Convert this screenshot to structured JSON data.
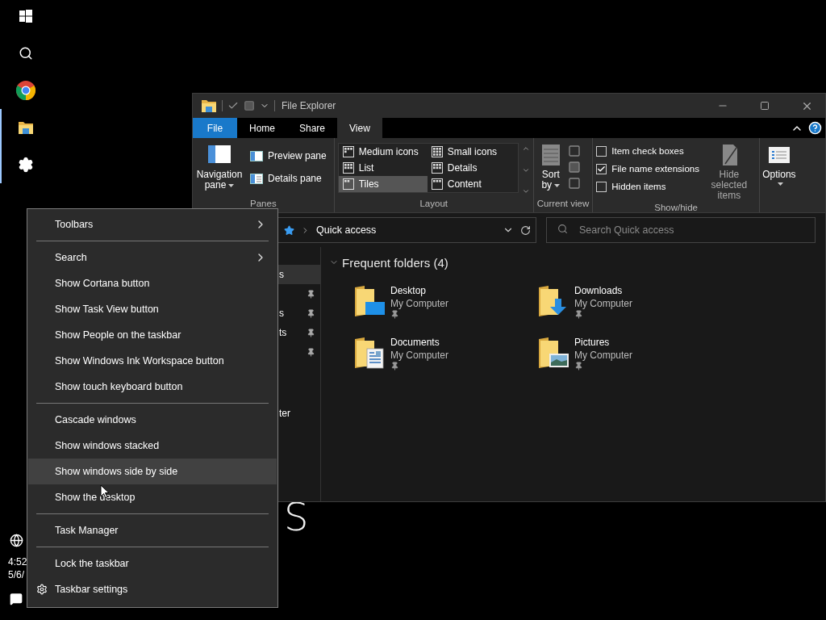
{
  "taskbar": {
    "apps": [
      {
        "kind": "start",
        "open": false
      },
      {
        "kind": "search",
        "open": false
      },
      {
        "kind": "chrome",
        "open": false
      },
      {
        "kind": "explorer",
        "open": true
      },
      {
        "kind": "settings",
        "open": true
      }
    ],
    "clock_time": "4:52",
    "clock_date": "5/6/"
  },
  "desktop_text": "S",
  "explorer": {
    "title": "File Explorer",
    "tabs": [
      {
        "label": "File",
        "kind": "file",
        "selected": false
      },
      {
        "label": "Home",
        "kind": "tab",
        "selected": false
      },
      {
        "label": "Share",
        "kind": "tab",
        "selected": false
      },
      {
        "label": "View",
        "kind": "tab",
        "selected": true
      }
    ],
    "ribbon": {
      "panes": {
        "label": "Panes",
        "navigation_pane": "Navigation pane",
        "items": [
          {
            "label": "Preview pane",
            "kind": "preview"
          },
          {
            "label": "Details pane",
            "kind": "details"
          }
        ]
      },
      "layout": {
        "label": "Layout",
        "items": [
          {
            "label": "Medium icons",
            "kind": "medium",
            "selected": false
          },
          {
            "label": "Small icons",
            "kind": "small",
            "selected": false
          },
          {
            "label": "List",
            "kind": "list",
            "selected": false
          },
          {
            "label": "Details",
            "kind": "details",
            "selected": false
          },
          {
            "label": "Tiles",
            "kind": "tiles",
            "selected": true
          },
          {
            "label": "Content",
            "kind": "content",
            "selected": false
          }
        ]
      },
      "current_view": {
        "label": "Current view",
        "sort": "Sort by"
      },
      "show_hide": {
        "label": "Show/hide",
        "checkboxes": [
          {
            "label": "Item check boxes",
            "checked": false
          },
          {
            "label": "File name extensions",
            "checked": true
          },
          {
            "label": "Hidden items",
            "checked": false
          }
        ],
        "hide_selected": "Hide selected items"
      },
      "options": "Options"
    },
    "address": "Quick access",
    "search": {
      "placeholder": "Search Quick access"
    },
    "nav_items": [
      {
        "label": "s",
        "kind": "item",
        "selected": true,
        "pinned": false
      },
      {
        "kind": "item",
        "selected": false,
        "pinned": true
      },
      {
        "label": "s",
        "kind": "item",
        "selected": false,
        "pinned": true
      },
      {
        "label": "ts",
        "kind": "item",
        "selected": false,
        "pinned": true
      },
      {
        "kind": "item",
        "selected": false,
        "pinned": true
      },
      {
        "label": "ter",
        "kind": "group",
        "selected": false,
        "pinned": false
      }
    ],
    "section_title": "Frequent folders (4)",
    "folders": [
      {
        "name": "Desktop",
        "location": "My Computer",
        "kind": "desktop"
      },
      {
        "name": "Downloads",
        "location": "My Computer",
        "kind": "downloads"
      },
      {
        "name": "Documents",
        "location": "My Computer",
        "kind": "documents"
      },
      {
        "name": "Pictures",
        "location": "My Computer",
        "kind": "pictures"
      }
    ]
  },
  "context_menu": [
    {
      "kind": "submenu",
      "label": "Toolbars",
      "selected": false
    },
    {
      "kind": "separator"
    },
    {
      "kind": "submenu",
      "label": "Search",
      "selected": false
    },
    {
      "kind": "item",
      "label": "Show Cortana button",
      "selected": false
    },
    {
      "kind": "item",
      "label": "Show Task View button",
      "selected": false
    },
    {
      "kind": "item",
      "label": "Show People on the taskbar",
      "selected": false
    },
    {
      "kind": "item",
      "label": "Show Windows Ink Workspace button",
      "selected": false
    },
    {
      "kind": "item",
      "label": "Show touch keyboard button",
      "selected": false
    },
    {
      "kind": "separator"
    },
    {
      "kind": "item",
      "label": "Cascade windows",
      "selected": false
    },
    {
      "kind": "item",
      "label": "Show windows stacked",
      "selected": false
    },
    {
      "kind": "item",
      "label": "Show windows side by side",
      "selected": true
    },
    {
      "kind": "item",
      "label": "Show the desktop",
      "selected": false
    },
    {
      "kind": "separator"
    },
    {
      "kind": "item",
      "label": "Task Manager",
      "selected": false
    },
    {
      "kind": "separator"
    },
    {
      "kind": "item",
      "label": "Lock the taskbar",
      "selected": false
    },
    {
      "kind": "settings",
      "label": "Taskbar settings",
      "selected": false
    }
  ]
}
